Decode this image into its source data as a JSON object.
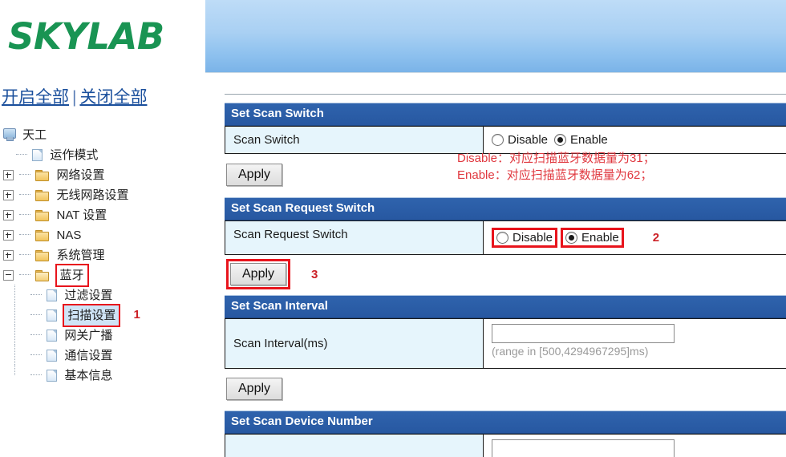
{
  "brand": {
    "logo_text": "SKYLAB"
  },
  "toplinks": {
    "expand_all": "开启全部",
    "separator": "|",
    "collapse_all": "关闭全部"
  },
  "tree": {
    "root": "天工",
    "items": [
      {
        "label": "运作模式",
        "icon": "document-icon",
        "type": "doc",
        "level": 1
      },
      {
        "label": "网络设置",
        "icon": "folder-icon",
        "type": "folder",
        "level": 1,
        "expander": "plus"
      },
      {
        "label": "无线网路设置",
        "icon": "folder-icon",
        "type": "folder",
        "level": 1,
        "expander": "plus"
      },
      {
        "label": "NAT 设置",
        "icon": "folder-icon",
        "type": "folder",
        "level": 1,
        "expander": "plus"
      },
      {
        "label": "NAS",
        "icon": "folder-icon",
        "type": "folder",
        "level": 1,
        "expander": "plus"
      },
      {
        "label": "系统管理",
        "icon": "folder-icon",
        "type": "folder",
        "level": 1,
        "expander": "plus"
      },
      {
        "label": "蓝牙",
        "icon": "folder-open-icon",
        "type": "folder",
        "level": 1,
        "expander": "minus",
        "highlighted": true
      },
      {
        "label": "过滤设置",
        "icon": "document-icon",
        "type": "doc",
        "level": 2
      },
      {
        "label": "扫描设置",
        "icon": "document-icon",
        "type": "doc",
        "level": 2,
        "selected": true,
        "highlighted": true,
        "annotation": "1"
      },
      {
        "label": "网关广播",
        "icon": "document-icon",
        "type": "doc",
        "level": 2
      },
      {
        "label": "通信设置",
        "icon": "document-icon",
        "type": "doc",
        "level": 2
      },
      {
        "label": "基本信息",
        "icon": "document-icon",
        "type": "doc",
        "level": 2
      }
    ]
  },
  "sections": [
    {
      "title": "Set Scan Switch",
      "label": "Scan Switch",
      "radios": [
        {
          "label": "Disable",
          "selected": false
        },
        {
          "label": "Enable",
          "selected": true
        }
      ],
      "apply_label": "Apply"
    },
    {
      "title": "Set Scan Request Switch",
      "label": "Scan Request Switch",
      "radios": [
        {
          "label": "Disable",
          "selected": false,
          "highlighted": true
        },
        {
          "label": "Enable",
          "selected": true,
          "highlighted": true
        }
      ],
      "annotation": "2",
      "apply_label": "Apply",
      "apply_highlighted": true,
      "apply_annotation": "3"
    },
    {
      "title": "Set Scan Interval",
      "label": "Scan Interval(ms)",
      "input_value": "",
      "input_hint": "(range in [500,4294967295]ms)",
      "apply_label": "Apply"
    },
    {
      "title": "Set Scan Device Number",
      "label": "",
      "input_value": ""
    }
  ],
  "notes": {
    "line1": "Disable：对应扫描蓝牙数据量为31；",
    "line2": "Enable：对应扫描蓝牙数据量为62；"
  },
  "colors": {
    "brand_green": "#199453",
    "header_blue": "#2758a1",
    "label_cell_bg": "#e6f5fc",
    "annotation_red": "#cc2127",
    "note_red": "#e0383f",
    "link_blue": "#1a4f9c",
    "highlight_red": "#e8141c"
  }
}
